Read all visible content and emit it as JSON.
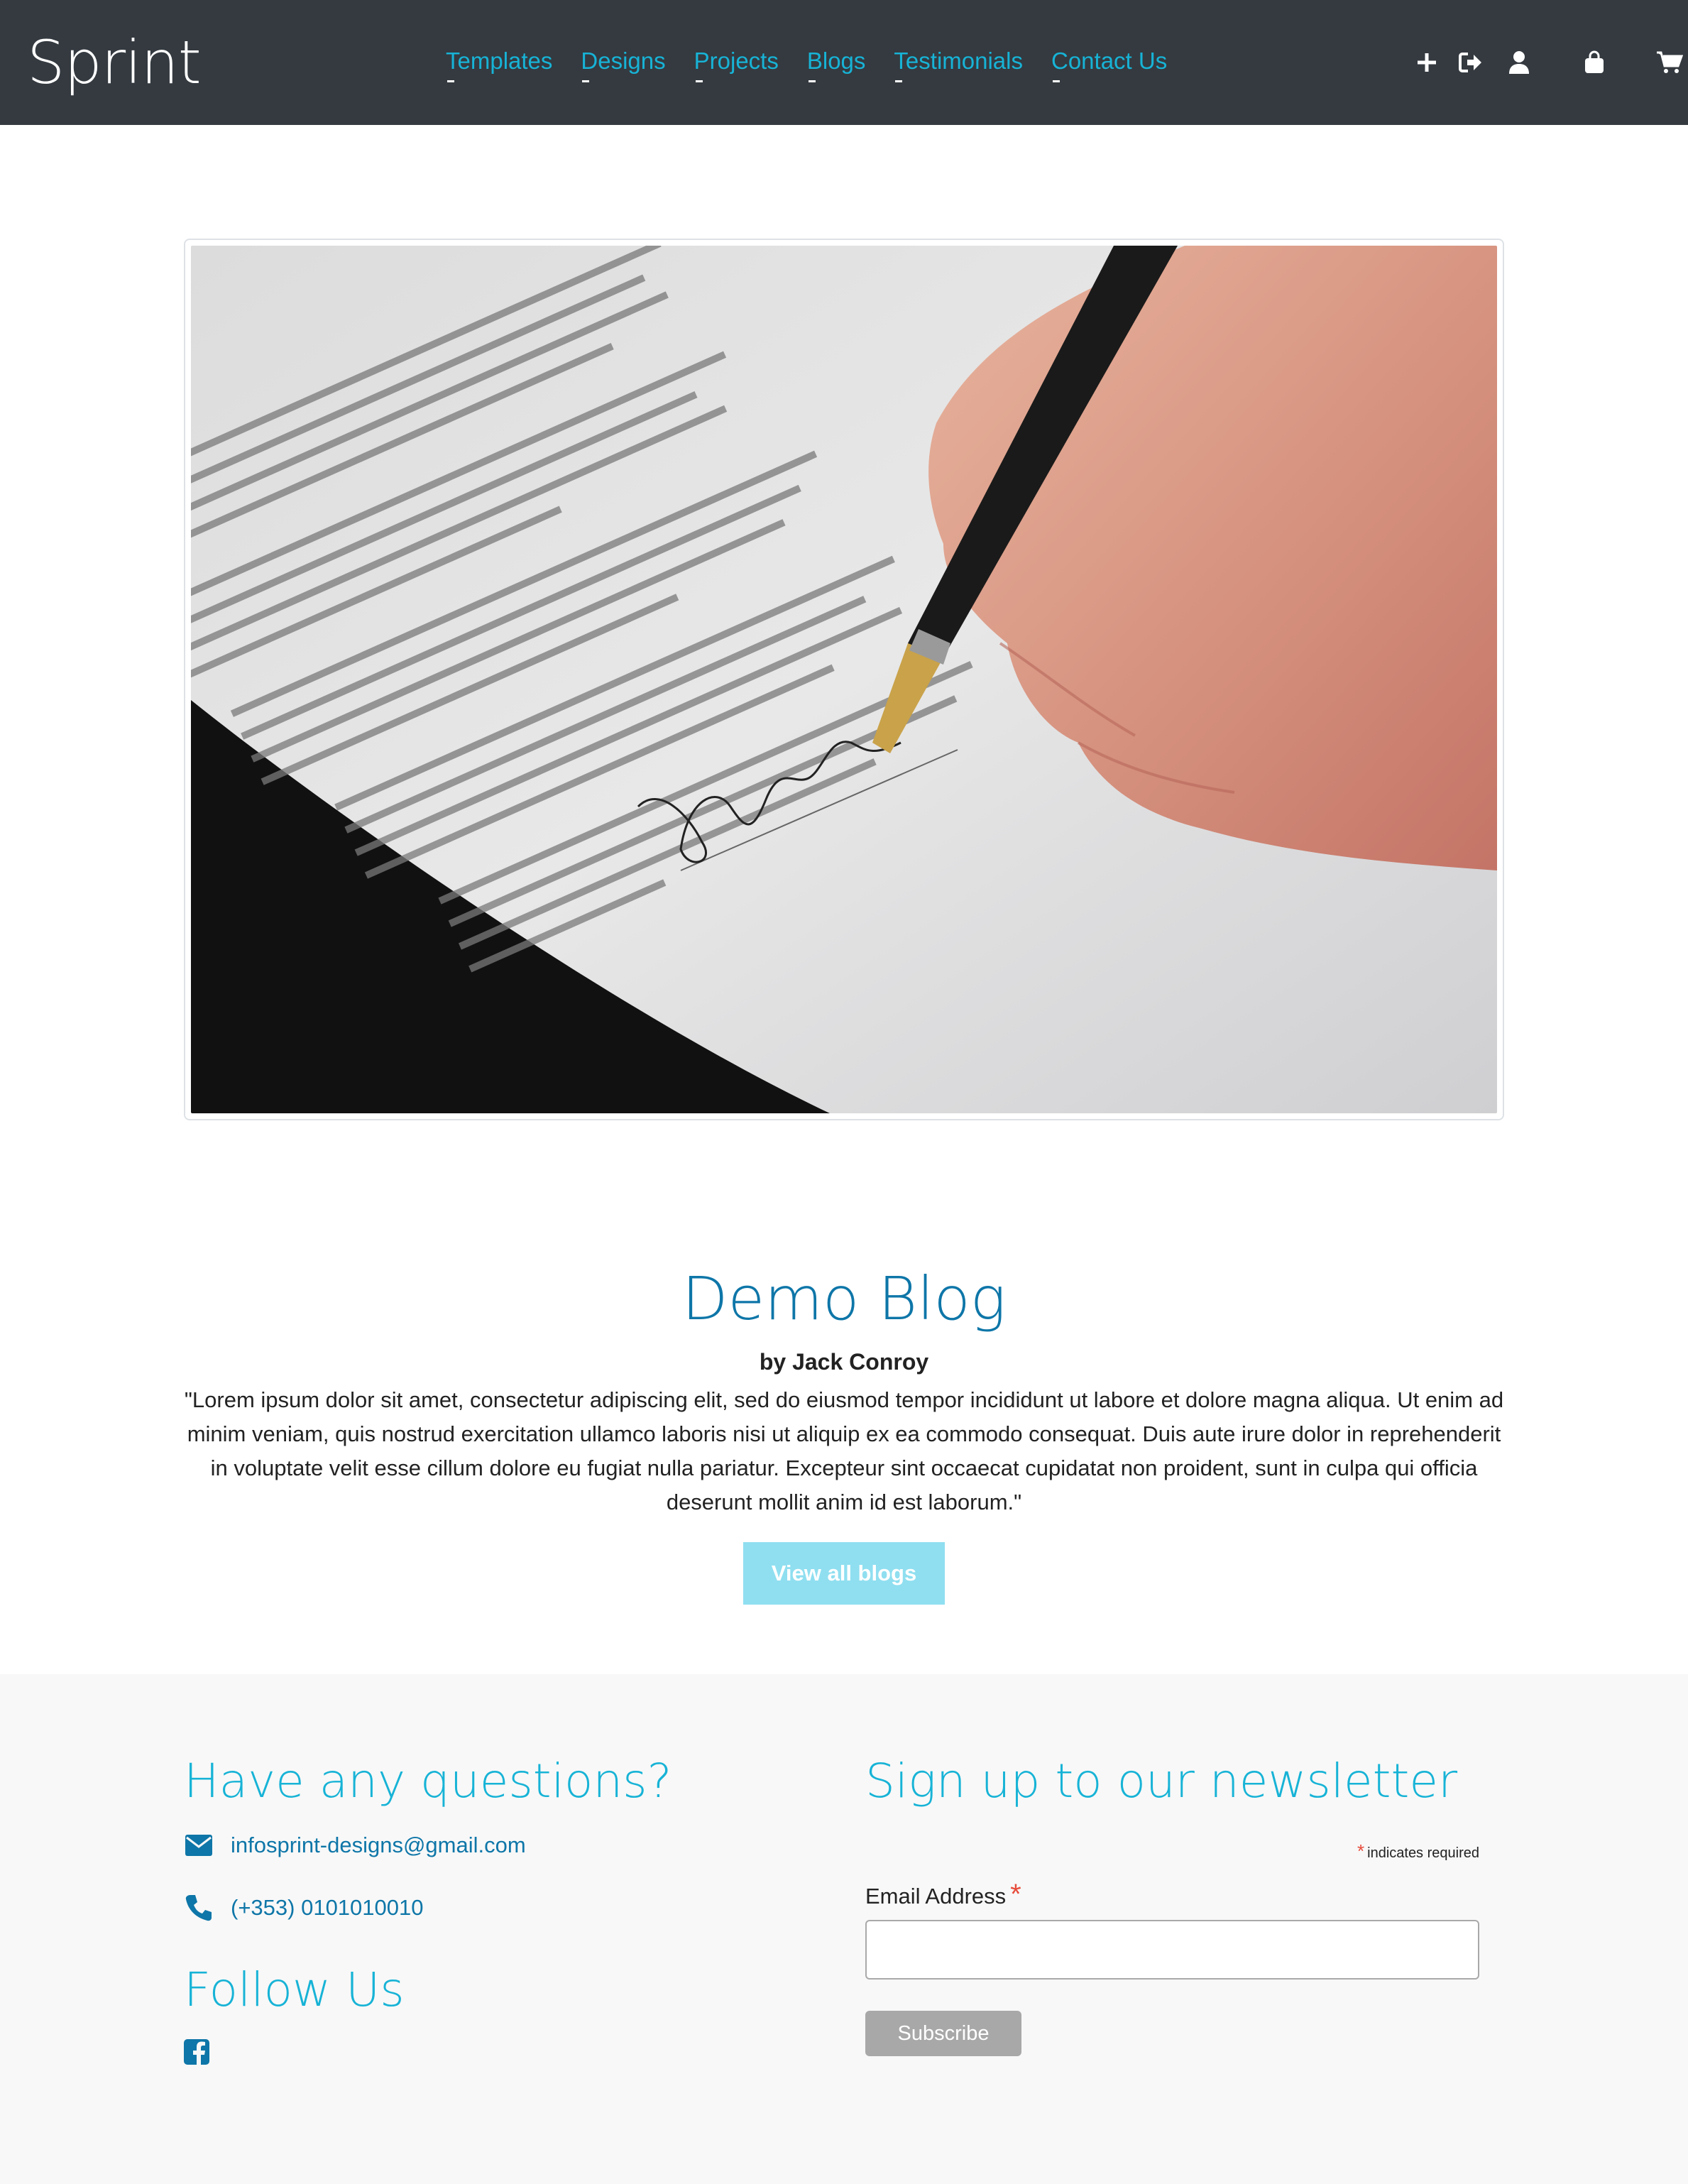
{
  "brand": "Sprint",
  "nav": {
    "links": [
      "Templates",
      "Designs",
      "Projects",
      "Blogs",
      "Testimonials",
      "Contact Us"
    ],
    "icons": [
      "plus-icon",
      "sign-out-icon",
      "user-icon",
      "shopping-bag-icon",
      "cart-icon"
    ]
  },
  "hero": {
    "image_subject": "hand signing document with fountain pen"
  },
  "blog": {
    "title": "Demo Blog",
    "author": "by Jack Conroy",
    "body": "\"Lorem ipsum dolor sit amet, consectetur adipiscing elit, sed do eiusmod tempor incididunt ut labore et dolore magna aliqua. Ut enim ad minim veniam, quis nostrud exercitation ullamco laboris nisi ut aliquip ex ea commodo consequat. Duis aute irure dolor in reprehenderit in voluptate velit esse cillum dolore eu fugiat nulla pariatur. Excepteur sint occaecat cupidatat non proident, sunt in culpa qui officia deserunt mollit anim id est laborum.\"",
    "button_label": "View all blogs"
  },
  "footer": {
    "questions_heading": "Have any questions?",
    "email": "infosprint-designs@gmail.com",
    "phone": "(+353) 0101010010",
    "follow_heading": "Follow Us",
    "newsletter_heading": "Sign up to our newsletter",
    "required_star": "*",
    "required_note": "indicates required",
    "email_label": "Email Address",
    "email_value": "",
    "subscribe_label": "Subscribe"
  },
  "colors": {
    "navbar": "#343a40",
    "accent": "#17b3d6",
    "heading_blue": "#0e76a8",
    "button_light": "#8fdff0",
    "footer_bg": "#f8f8f8"
  }
}
